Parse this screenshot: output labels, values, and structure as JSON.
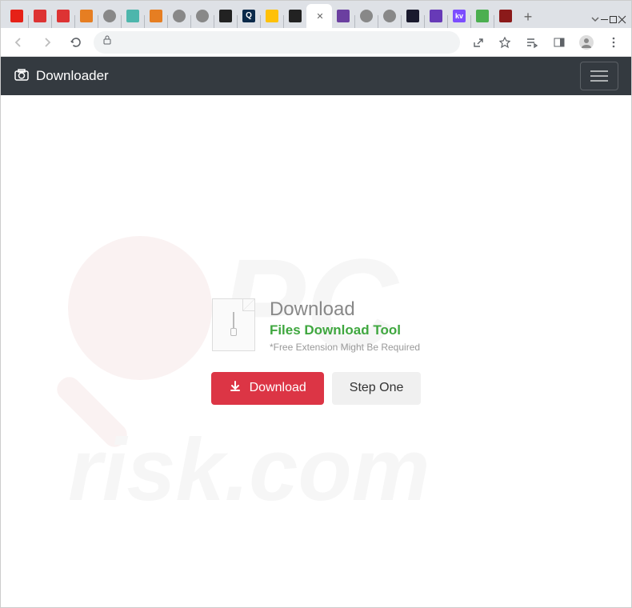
{
  "window": {
    "tabs": [
      {
        "icon": "fav-red"
      },
      {
        "icon": "fav-dl"
      },
      {
        "icon": "fav-dl"
      },
      {
        "icon": "fav-orange"
      },
      {
        "icon": "fav-globe"
      },
      {
        "icon": "fav-teal"
      },
      {
        "icon": "fav-orange"
      },
      {
        "icon": "fav-globe"
      },
      {
        "icon": "fav-globe"
      },
      {
        "icon": "fav-pause"
      },
      {
        "icon": "fav-q",
        "text": "Q"
      },
      {
        "icon": "fav-warn"
      },
      {
        "icon": "fav-dark"
      },
      {
        "icon": "active"
      },
      {
        "icon": "fav-purple"
      },
      {
        "icon": "fav-globe"
      },
      {
        "icon": "fav-globe"
      },
      {
        "icon": "fav-moon"
      },
      {
        "icon": "fav-vbar"
      },
      {
        "icon": "fav-kv",
        "text": "kv"
      },
      {
        "icon": "fav-green"
      },
      {
        "icon": "fav-darkred"
      }
    ]
  },
  "header": {
    "brand": "Downloader"
  },
  "main": {
    "title": "Download",
    "subtitle": "Files Download Tool",
    "note": "*Free Extension Might Be Required",
    "download_btn": "Download",
    "step_btn": "Step One"
  },
  "colors": {
    "accent_green": "#3fa73f",
    "btn_danger": "#dc3545",
    "header_bg": "#343a40"
  }
}
